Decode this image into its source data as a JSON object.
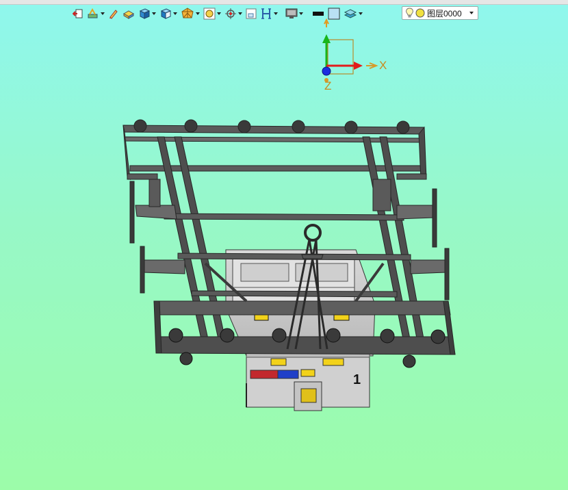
{
  "toolbar": {
    "icons": [
      "exit-sketch-icon",
      "sketch-tools-icon",
      "pencil-icon",
      "solid-box-icon",
      "cube-shaded-icon",
      "view-orientation-icon",
      "wireframe-polyhedron-icon",
      "zoom-fit-icon",
      "snap-point-icon",
      "single-view-icon",
      "section-view-icon",
      "display-monitor-icon",
      "line-color-icon",
      "fill-color-icon",
      "layer-manager-icon"
    ],
    "layer_select": {
      "value": "图层0000"
    }
  },
  "triad": {
    "x_label": "X",
    "z_label": "Z"
  },
  "model": {
    "part_label": "1"
  },
  "colors": {
    "background_top": "#8ff7ee",
    "background_bottom": "#9cfca9",
    "frame": "#4a4a4a",
    "frame_light": "#7c7c7c",
    "body_gray": "#c9c9c9",
    "accent_yellow": "#f2d21a",
    "accent_red": "#c2282d",
    "accent_blue": "#1f3fc8",
    "axis_x": "#e21b1b",
    "axis_y": "#17b51b",
    "axis_z": "#1a2ee0"
  }
}
